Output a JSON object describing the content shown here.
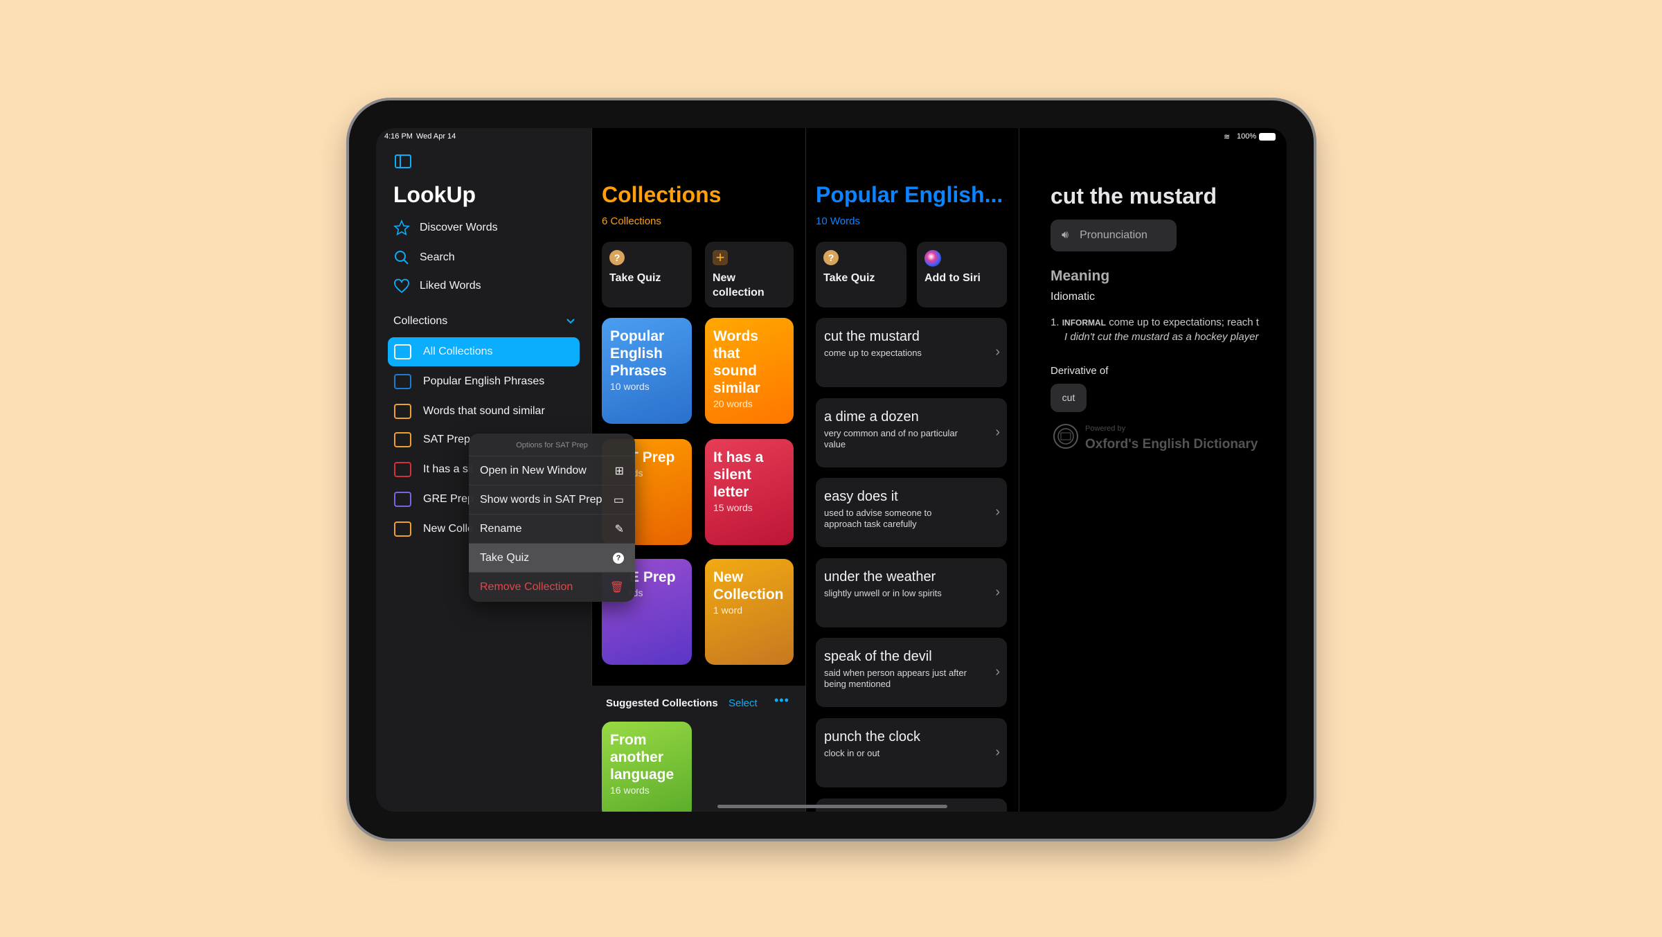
{
  "status": {
    "time": "4:16 PM",
    "date": "Wed Apr 14",
    "battery": "100%"
  },
  "sidebar": {
    "app_title": "LookUp",
    "nav": [
      {
        "label": "Discover Words",
        "icon": "star-icon"
      },
      {
        "label": "Search",
        "icon": "search-icon"
      },
      {
        "label": "Liked Words",
        "icon": "heart-icon"
      }
    ],
    "collections_header": "Collections",
    "collections": [
      {
        "label": "All Collections",
        "color": "#ffffff",
        "selected": true
      },
      {
        "label": "Popular English Phrases",
        "color": "#1e7ad8"
      },
      {
        "label": "Words that sound similar",
        "color": "#f0a030"
      },
      {
        "label": "SAT Prep",
        "color": "#f0a030"
      },
      {
        "label": "It has a sil",
        "color": "#d8303a"
      },
      {
        "label": "GRE Prep",
        "color": "#7a64e6"
      },
      {
        "label": "New Colle",
        "color": "#f0a030"
      }
    ]
  },
  "context_menu": {
    "header": "Options for SAT Prep",
    "items": [
      {
        "label": "Open in New Window",
        "icon": "grid-icon"
      },
      {
        "label": "Show words in SAT Prep",
        "icon": "stack-icon"
      },
      {
        "label": "Rename",
        "icon": "edit-icon"
      },
      {
        "label": "Take Quiz",
        "icon": "question-icon",
        "highlighted": true
      },
      {
        "label": "Remove Collection",
        "icon": "trash-icon",
        "destructive": true
      }
    ]
  },
  "collections_pane": {
    "title": "Collections",
    "subtitle": "6 Collections",
    "accent": "#ff9f0a",
    "actions": [
      {
        "label": "Take Quiz"
      },
      {
        "label": "New collection"
      }
    ],
    "tiles": [
      {
        "name": "Popular English Phrases",
        "count": "10 words",
        "colors": [
          "#4b9ef2",
          "#2a70cc"
        ]
      },
      {
        "name": "Words that sound similar",
        "count": "20 words",
        "colors": [
          "#ffa800",
          "#ff7600"
        ]
      },
      {
        "name": "T Prep",
        "count": "rds",
        "colors": [
          "#ff9c00",
          "#e86400"
        ]
      },
      {
        "name": "It has a silent letter",
        "count": "15 words",
        "colors": [
          "#e63d57",
          "#bd1535"
        ]
      },
      {
        "name": "E Prep",
        "count": "rds",
        "colors": [
          "#9a4ed0",
          "#5a36c6"
        ]
      },
      {
        "name": "New Collection",
        "count": "1 word",
        "colors": [
          "#f2aa12",
          "#c67820"
        ]
      }
    ],
    "suggested": {
      "title": "Suggested Collections",
      "select": "Select",
      "tiles": [
        {
          "name": "From another language",
          "count": "16 words",
          "colors": [
            "#98da44",
            "#5aab2a"
          ]
        }
      ]
    }
  },
  "phrases_pane": {
    "title": "Popular English...",
    "subtitle": "10 Words",
    "accent": "#0a84ff",
    "actions": [
      {
        "label": "Take Quiz"
      },
      {
        "label": "Add to Siri"
      }
    ],
    "items": [
      {
        "phrase": "cut the mustard",
        "def": "come up to expectations"
      },
      {
        "phrase": "a dime a dozen",
        "def": "very common and of no particular value"
      },
      {
        "phrase": "easy does it",
        "def": "used to advise someone to approach task carefully"
      },
      {
        "phrase": "under the weather",
        "def": "slightly unwell or in low spirits"
      },
      {
        "phrase": "speak of the devil",
        "def": "said when person appears just after being mentioned"
      },
      {
        "phrase": "punch the clock",
        "def": "clock in or out"
      }
    ]
  },
  "detail": {
    "title": "cut the mustard",
    "pronunciation": "Pronunciation",
    "meaning": "Meaning",
    "pos": "Idiomatic",
    "def_num": "1.",
    "def_tag": "INFORMAL",
    "def_text": "come up to expectations; reach t",
    "example": "I didn't cut the mustard as a hockey player",
    "derivative_label": "Derivative of",
    "derivative": "cut",
    "powered_by": "Powered by",
    "source": "Oxford's English Dictionary"
  }
}
